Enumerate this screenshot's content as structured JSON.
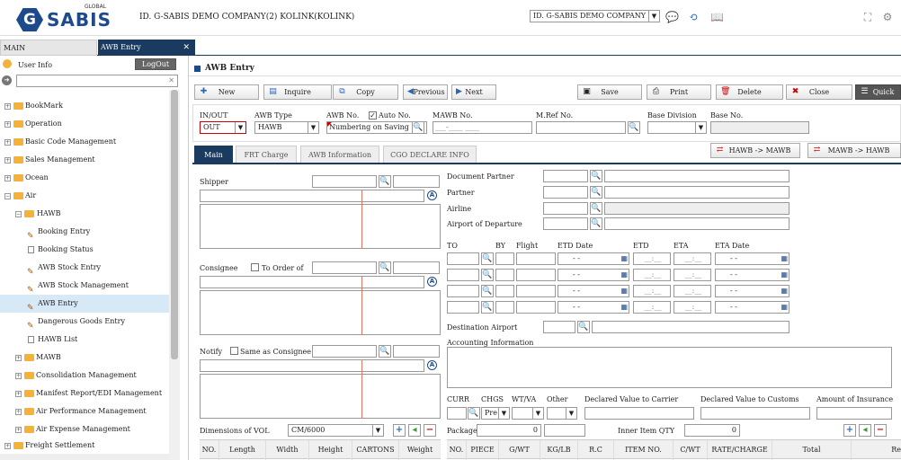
{
  "header": {
    "logo_small": "GLOBAL",
    "logo_text": "SABIS",
    "logo_letter": "G",
    "company": "ID. G-SABIS DEMO COMPANY(2) KOLINK(KOLINK)",
    "company_select": "ID. G-SABIS DEMO COMPANY"
  },
  "tabs": [
    {
      "label": "MAIN"
    },
    {
      "label": "AWB Entry"
    }
  ],
  "sidebar": {
    "user_info": "User Info",
    "logout": "LogOut",
    "search_value": "",
    "items": [
      {
        "label": "BookMark"
      },
      {
        "label": "Operation"
      },
      {
        "label": "Basic Code Management"
      },
      {
        "label": "Sales Management"
      },
      {
        "label": "Ocean"
      },
      {
        "label": "Air"
      },
      {
        "label": "HAWB"
      },
      {
        "label": "Booking Entry"
      },
      {
        "label": "Booking Status"
      },
      {
        "label": "AWB Stock Entry"
      },
      {
        "label": "AWB Stock Management"
      },
      {
        "label": "AWB Entry"
      },
      {
        "label": "Dangerous Goods Entry"
      },
      {
        "label": "HAWB List"
      },
      {
        "label": "MAWB"
      },
      {
        "label": "Consolidation Management"
      },
      {
        "label": "Manifest Report/EDI Management"
      },
      {
        "label": "Air Performance Management"
      },
      {
        "label": "Air Expense Management"
      },
      {
        "label": "Freight Settlement"
      }
    ]
  },
  "page": {
    "title": "AWB Entry"
  },
  "toolbar": {
    "new": "New",
    "inquire": "Inquire",
    "copy": "Copy",
    "previous": "Previous",
    "next": "Next",
    "save": "Save",
    "print": "Print",
    "delete": "Delete",
    "close": "Close",
    "quick": "Quick"
  },
  "form": {
    "inout_label": "IN/OUT",
    "inout_value": "OUT",
    "awb_type_label": "AWB Type",
    "awb_type_value": "HAWB",
    "awb_no_label": "AWB No.",
    "auto_no_label": "Auto No.",
    "awb_no_value": "Numbering on Saving",
    "mawb_no_label": "MAWB No.",
    "mawb_no_value": "___-____ ____",
    "mref_label": "M.Ref No.",
    "base_division_label": "Base Division",
    "base_no_label": "Base No."
  },
  "subtabs": [
    {
      "label": "Main"
    },
    {
      "label": "FRT Charge"
    },
    {
      "label": "AWB Information"
    },
    {
      "label": "CGO DECLARE INFO"
    }
  ],
  "convert": {
    "h2m": "HAWB -> MAWB",
    "m2h": "MAWB -> HAWB"
  },
  "left": {
    "shipper": "Shipper",
    "consignee": "Consignee",
    "to_order_of": "To Order of",
    "notify": "Notify",
    "same_as_consignee": "Same as Consignee",
    "dimensions_label": "Dimensions of VOL",
    "dimensions_value": "CM/6000",
    "dim_headers": [
      "NO.",
      "Length",
      "Width",
      "Height",
      "CARTONS",
      "Weight"
    ]
  },
  "right": {
    "document_partner": "Document Partner",
    "partner": "Partner",
    "airline": "Airline",
    "airport_departure": "Airport of Departure",
    "route_headers": {
      "to": "TO",
      "by": "BY",
      "flight": "Flight",
      "etd_date": "ETD Date",
      "etd": "ETD",
      "eta": "ETA",
      "eta_date": "ETA Date"
    },
    "date_placeholder": "- -",
    "time_placeholder": "__:__",
    "destination_airport": "Destination Airport",
    "accounting_info": "Accounting Information",
    "curr": "CURR",
    "chgs": "CHGS",
    "wtva": "WT/VA",
    "other": "Other",
    "declared_carrier": "Declared Value to Carrier",
    "declared_customs": "Declared Value to Customs",
    "insurance": "Amount of Insurance",
    "chgs_value": "Pre",
    "package_label": "Package",
    "package_value": "0",
    "inner_item_label": "Inner Item QTY",
    "inner_item_value": "0",
    "piece_headers": [
      "NO.",
      "PIECE",
      "G/WT",
      "KG/LB",
      "R.C",
      "ITEM NO.",
      "C/WT",
      "RATE/CHARGE",
      "Total",
      "Re"
    ]
  }
}
